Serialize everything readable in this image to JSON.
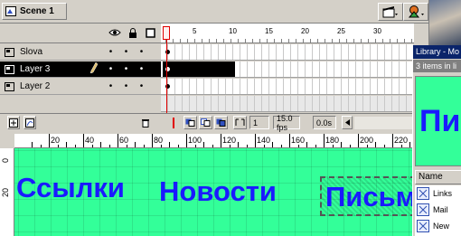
{
  "scene": {
    "label": "Scene 1"
  },
  "timeline": {
    "frame_numbers": [
      "1",
      "5",
      "10",
      "15",
      "20",
      "25",
      "30"
    ],
    "layers": [
      {
        "name": "Slova",
        "selected": false,
        "span_frames": 0
      },
      {
        "name": "Layer 3",
        "selected": true,
        "span_frames": 10
      },
      {
        "name": "Layer 2",
        "selected": false,
        "span_frames": 0
      }
    ],
    "current_frame": "1",
    "fps": "15.0 fps",
    "time": "0.0s"
  },
  "ruler": {
    "h_numbers": [
      "20",
      "40",
      "60",
      "80",
      "100",
      "120",
      "140",
      "160",
      "180",
      "200",
      "220"
    ],
    "v_numbers": [
      "0",
      "20"
    ]
  },
  "stage": {
    "texts": [
      "Ссылки",
      "Новости",
      "Письм"
    ],
    "bg_color": "#33ff99",
    "text_color": "#1a1aff"
  },
  "library": {
    "title": "Library - Mo",
    "count": "3 items in li",
    "preview_text": "Пи",
    "column": "Name",
    "items": [
      "Links",
      "Mail",
      "New"
    ]
  }
}
